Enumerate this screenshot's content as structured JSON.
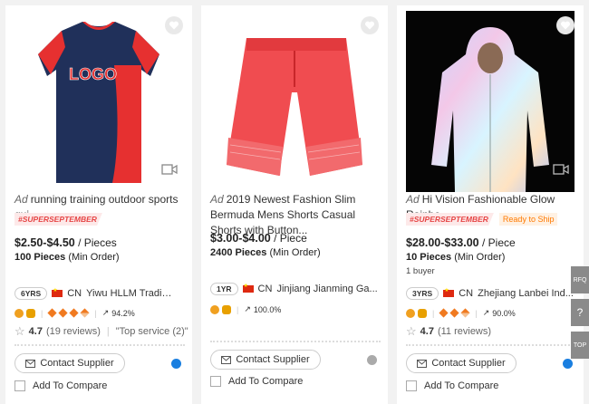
{
  "products": [
    {
      "ad_label": "Ad",
      "title": "running training outdoor sports qui...",
      "tags": [
        "#SUPERSEPTEMBER"
      ],
      "price": "$2.50-$4.50",
      "unit": "/ Pieces",
      "moq_value": "100 Pieces",
      "moq_suffix": "(Min Order)",
      "buyers": "",
      "years": "6YRS",
      "country": "CN",
      "supplier": "Yiwu HLLM Trading ...",
      "response": "94.2%",
      "rating": "4.7",
      "reviews": "(19 reviews)",
      "review_note": "\"Top service (2)\"",
      "contact_label": "Contact Supplier",
      "compare_label": "Add To Compare",
      "image_icon": "sports-tshirt-image"
    },
    {
      "ad_label": "Ad",
      "title": "2019 Newest Fashion Slim Bermuda Mens Shorts Casual Shorts with Button...",
      "tags": [],
      "price": "$3.00-$4.00",
      "unit": "/ Piece",
      "moq_value": "2400 Pieces",
      "moq_suffix": "(Min Order)",
      "years": "1YR",
      "country": "CN",
      "supplier": "Jinjiang Jianming Ga...",
      "response": "100.0%",
      "contact_label": "Contact Supplier",
      "compare_label": "Add To Compare",
      "image_icon": "shorts-image"
    },
    {
      "ad_label": "Ad",
      "title": "Hi Vision Fashionable Glow Rainbo...",
      "tags": [
        "#SUPERSEPTEMBER",
        "Ready to Ship"
      ],
      "price": "$28.00-$33.00",
      "unit": "/ Piece",
      "moq_value": "10 Pieces",
      "moq_suffix": "(Min Order)",
      "buyers": "1 buyer",
      "years": "3YRS",
      "country": "CN",
      "supplier": "Zhejiang Lanbei Ind...",
      "response": "90.0%",
      "rating": "4.7",
      "reviews": "(11 reviews)",
      "contact_label": "Contact Supplier",
      "compare_label": "Add To Compare",
      "image_icon": "reflective-jacket-image"
    }
  ],
  "side_tools": {
    "rfq": "RFQ",
    "help": "?",
    "top": "TOP"
  },
  "colors": {
    "price_accent": "#222222",
    "tag_red": "#e64545",
    "ship_orange": "#ff7a00",
    "online_blue": "#1a7fe0"
  }
}
